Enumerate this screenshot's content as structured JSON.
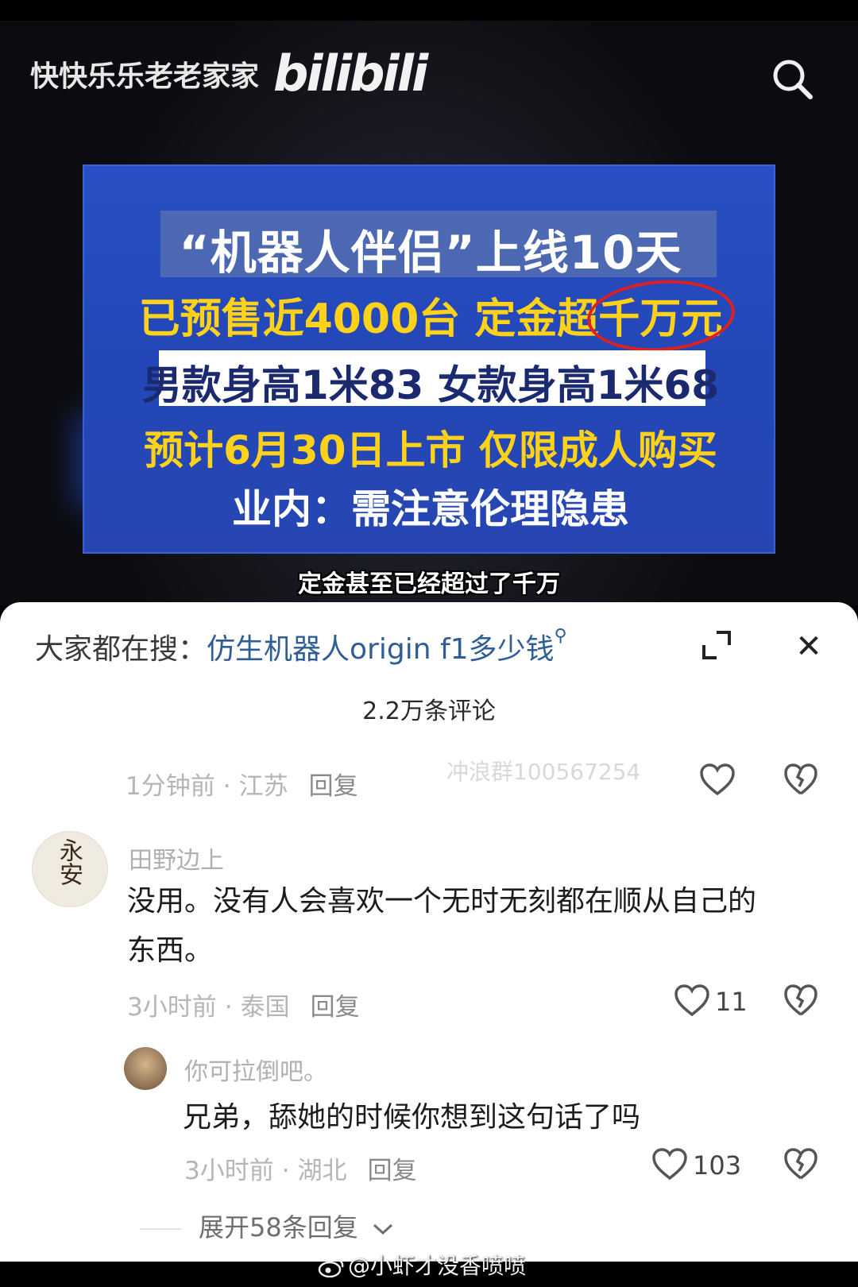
{
  "video": {
    "channel_name": "快快乐乐老老家家",
    "logo_text": "bilibili",
    "card": {
      "line1": "“机器人伴侣”上线10天",
      "line2_prefix": "已预售近4000台 定金超",
      "line2_circled": "千万元",
      "line3": "男款身高1米83 女款身高1米68",
      "line4": "预计6月30日上市 仅限成人购买",
      "line5": "业内：需注意伦理隐患"
    },
    "subtitle": "定金甚至已经超过了千万"
  },
  "sheet": {
    "search_label": "大家都在搜：",
    "search_query": "仿生机器人origin f1多少钱",
    "search_icon_glyph": "⚲",
    "close_glyph": "✕",
    "comment_count": "2.2万条评论",
    "ghost_watermark": "冲浪群100567254",
    "top_comment": {
      "time": "1分钟前",
      "location": "江苏",
      "reply": "回复"
    },
    "comment1": {
      "username": "田野边上",
      "avatar_glyph": "永安",
      "text_line1": "没用。没有人会喜欢一个无时无刻都在顺从自己的",
      "text_line2": "东西。",
      "time": "3小时前",
      "location": "泰国",
      "reply": "回复",
      "likes": "11"
    },
    "reply1": {
      "username": "你可拉倒吧。",
      "text": "兄弟，舔她的时候你想到这句话了吗",
      "time": "3小时前",
      "location": "湖北",
      "reply": "回复",
      "likes": "103"
    },
    "expand_more": "展开58条回复",
    "dot": "·"
  },
  "weibo_watermark": "@小虾才没香喷喷",
  "colors": {
    "card_blue": "#2347b7",
    "headline_yellow": "#ffd21a",
    "circle_red": "#e02020",
    "link_blue": "#2e5e95"
  }
}
